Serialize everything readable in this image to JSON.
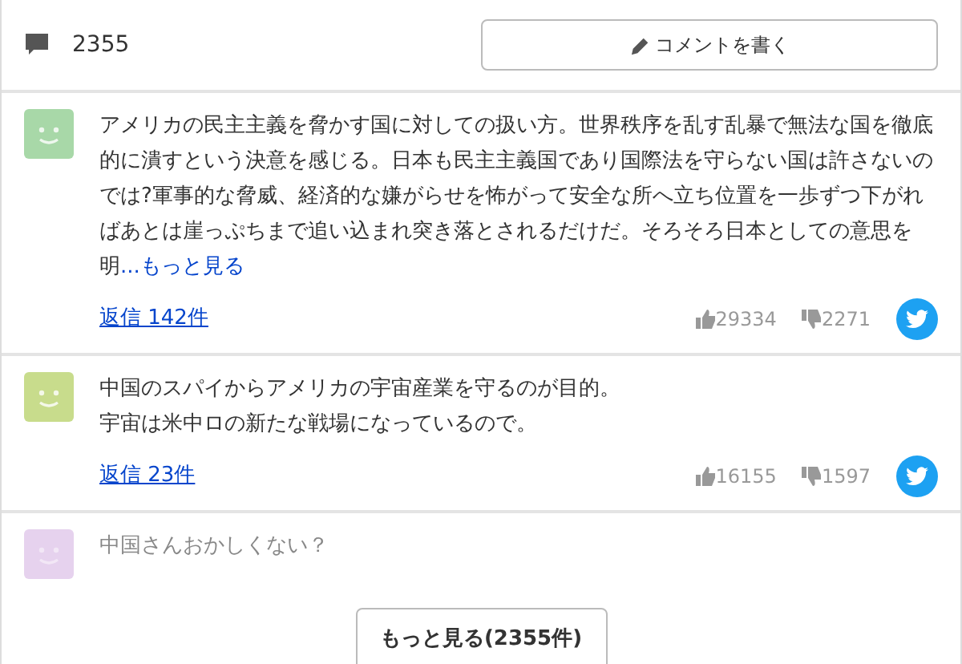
{
  "header": {
    "comment_count": "2355",
    "write_button": "コメントを書く"
  },
  "comments": [
    {
      "color": "#a8d8a8",
      "faded": false,
      "lines": [
        "アメリカの民主主義を脅かす国に対しての扱い方。世界秩序を乱す乱暴で無法な国を徹底的に潰すという決意を感じる。日本も民主主義国であり国際法を守らない国は許さないのでは?軍事的な脅威、経済的な嫌がらせを怖がって安全な所へ立ち位置を一歩ずつ下がればあとは崖っぷちまで追い込まれ突き落とされるだけだ。そろそろ日本としての意思を明"
      ],
      "more_link": "...もっと見る",
      "replies": "返信 142件",
      "likes": "29334",
      "dislikes": "2271"
    },
    {
      "color": "#c8dc8c",
      "faded": false,
      "lines": [
        "中国のスパイからアメリカの宇宙産業を守るのが目的。",
        "宇宙は米中ロの新たな戦場になっているので。"
      ],
      "replies": "返信 23件",
      "likes": "16155",
      "dislikes": "1597"
    },
    {
      "color": "#e6d2ee",
      "faded": true,
      "lines": [
        "中国さんおかしくない？"
      ]
    }
  ],
  "load_more_button": "もっと見る(2355件)"
}
